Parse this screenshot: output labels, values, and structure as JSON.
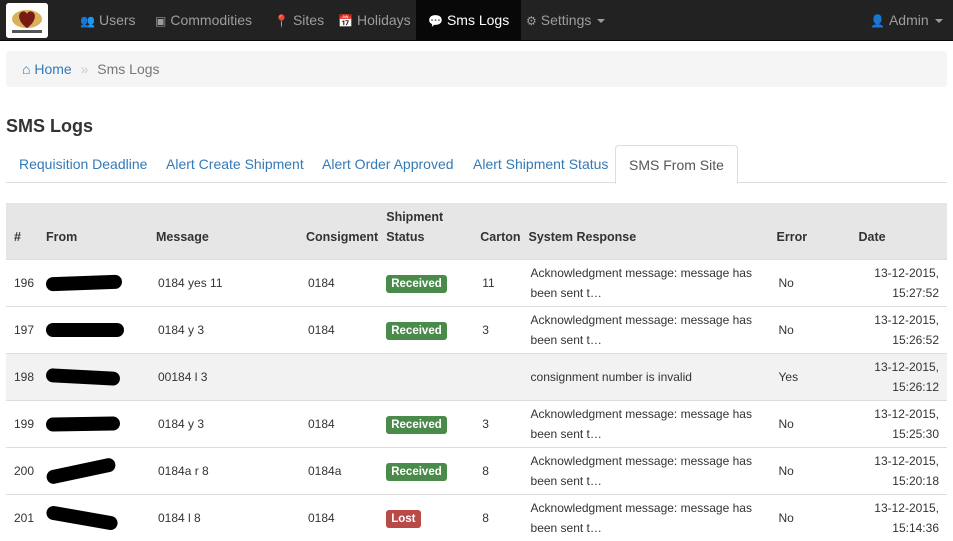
{
  "navbar": {
    "brand_logo_text": "DEPARTMENT OF HEALTH",
    "items": [
      {
        "label": "Users",
        "icon": "users-icon"
      },
      {
        "label": "Commodities",
        "icon": "briefcase-icon"
      },
      {
        "label": "Sites",
        "icon": "map-marker-icon"
      },
      {
        "label": "Holidays",
        "icon": "calendar-icon"
      },
      {
        "label": "Sms Logs",
        "icon": "comment-icon",
        "active": true
      },
      {
        "label": "Settings",
        "icon": "gear-icon",
        "dropdown": true
      }
    ],
    "user": {
      "label": "Admin",
      "icon": "user-icon",
      "dropdown": true
    }
  },
  "breadcrumb": {
    "home": "Home",
    "separator": "»",
    "current": "Sms Logs"
  },
  "page_title": "SMS Logs",
  "tabs": [
    {
      "label": "Requisition Deadline"
    },
    {
      "label": "Alert Create Shipment"
    },
    {
      "label": "Alert Order Approved"
    },
    {
      "label": "Alert Shipment Status"
    },
    {
      "label": "SMS From Site",
      "active": true
    }
  ],
  "table": {
    "headers": {
      "num": "#",
      "from": "From",
      "message": "Message",
      "consignment": "Consigment",
      "status_line1": "Shipment",
      "status_line2": "Status",
      "carton": "Carton",
      "response": "System Response",
      "error": "Error",
      "date": "Date"
    },
    "rows": [
      {
        "num": "196",
        "message": "0184 yes 11",
        "consignment": "0184",
        "status": "Received",
        "carton": "11",
        "response": "Acknowledgment message: message has been sent t…",
        "error": "No",
        "date": "13-12-2015,",
        "time": "15:27:52"
      },
      {
        "num": "197",
        "message": "0184 y 3",
        "consignment": "0184",
        "status": "Received",
        "carton": "3",
        "response": "Acknowledgment message: message has been sent t…",
        "error": "No",
        "date": "13-12-2015,",
        "time": "15:26:52"
      },
      {
        "num": "198",
        "message": "00184 l 3",
        "consignment": "",
        "status": "",
        "carton": "",
        "response": "consignment number is invalid",
        "error": "Yes",
        "date": "13-12-2015,",
        "time": "15:26:12"
      },
      {
        "num": "199",
        "message": "0184 y 3",
        "consignment": "0184",
        "status": "Received",
        "carton": "3",
        "response": "Acknowledgment message: message has been sent t…",
        "error": "No",
        "date": "13-12-2015,",
        "time": "15:25:30"
      },
      {
        "num": "200",
        "message": "0184a r 8",
        "consignment": "0184a",
        "status": "Received",
        "carton": "8",
        "response": "Acknowledgment message: message has been sent t…",
        "error": "No",
        "date": "13-12-2015,",
        "time": "15:20:18"
      },
      {
        "num": "201",
        "message": "0184 l 8",
        "consignment": "0184",
        "status": "Lost",
        "carton": "8",
        "response": "Acknowledgment message: message has been sent t…",
        "error": "No",
        "date": "13-12-2015,",
        "time": "15:14:36"
      }
    ]
  },
  "colors": {
    "navbar_bg": "#222222",
    "link": "#337ab7",
    "received": "#4a8a4a",
    "lost": "#b94a48"
  }
}
